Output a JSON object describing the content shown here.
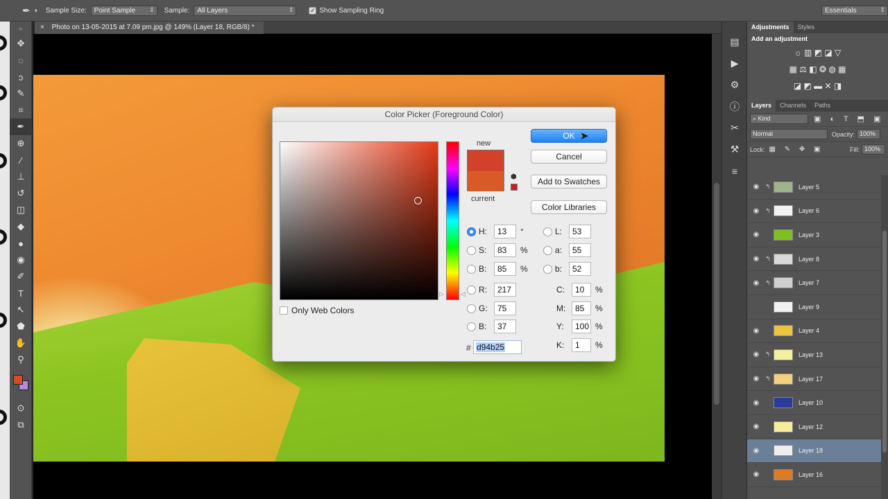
{
  "options_bar": {
    "sample_size_label": "Sample Size:",
    "sample_size_value": "Point Sample",
    "sample_label": "Sample:",
    "sample_value": "All Layers",
    "sampling_ring_label": "Show Sampling Ring",
    "workspace": "Essentials"
  },
  "document": {
    "tab_title": "Photo on 13-05-2015 at 7.09 pm.jpg @ 149% (Layer 18, RGB/8) *",
    "close": "×"
  },
  "toolbox": {
    "tools": [
      "move-icon",
      "marquee-icon",
      "lasso-icon",
      "quick-select-icon",
      "crop-icon",
      "eyedropper-icon",
      "healing-icon",
      "brush-icon",
      "stamp-icon",
      "history-brush-icon",
      "eraser-icon",
      "bucket-icon",
      "blur-icon",
      "dodge-icon",
      "pen-icon",
      "type-icon",
      "path-select-icon",
      "shape-icon",
      "hand-icon",
      "zoom-icon"
    ],
    "glyphs": [
      "✥",
      "◌",
      "ↄ",
      "✎",
      "⌗",
      "✒",
      "⊕",
      "∕",
      "⊥",
      "↺",
      "◫",
      "◆",
      "●",
      "◉",
      "✐",
      "T",
      "↖",
      "⬟",
      "✋",
      "⚲"
    ],
    "foreground_color": "#d94b25",
    "background_color": "#b889e0"
  },
  "panels": {
    "adjustments_tab": "Adjustments",
    "styles_tab": "Styles",
    "add_adjustment": "Add an adjustment",
    "adj_row1": "☼ ▥ ◩ ◪ ▽",
    "adj_row2": "▦ ⚖ ◧ ❂ ◍ ▦",
    "adj_row3": "◪ ◩ ▬ ✕ ◨",
    "layers_tab": "Layers",
    "channels_tab": "Channels",
    "paths_tab": "Paths",
    "kind_filter": "⌕ Kind",
    "filter_icons": "▣ ◐ T ⬒ ▣",
    "blend_mode": "Normal",
    "opacity_label": "Opacity:",
    "opacity_value": "100%",
    "lock_label": "Lock:",
    "lock_icons": "▦ ✎ ✥ ▣",
    "fill_label": "Fill:",
    "fill_value": "100%",
    "layers": [
      {
        "name": "Layer 5",
        "eye": "◉",
        "clip": "↰",
        "thumb": "#9fb48a"
      },
      {
        "name": "Layer 6",
        "eye": "◉",
        "clip": "↰",
        "thumb": "#f2f2f2"
      },
      {
        "name": "Layer 3",
        "eye": "◉",
        "clip": "",
        "thumb": "#7cc11e"
      },
      {
        "name": "Layer 8",
        "eye": "◉",
        "clip": "↰",
        "thumb": "#d8d8d8"
      },
      {
        "name": "Layer 7",
        "eye": "◉",
        "clip": "↰",
        "thumb": "#cfcfcf"
      },
      {
        "name": "Layer 9",
        "eye": "",
        "clip": "",
        "thumb": "#f2f2f2"
      },
      {
        "name": "Layer 4",
        "eye": "◉",
        "clip": "",
        "thumb": "#eac43c"
      },
      {
        "name": "Layer 13",
        "eye": "◉",
        "clip": "↰",
        "thumb": "#f3f0a0"
      },
      {
        "name": "Layer 17",
        "eye": "◉",
        "clip": "↰",
        "thumb": "#f5d080"
      },
      {
        "name": "Layer 10",
        "eye": "◉",
        "clip": "",
        "thumb": "#2c3a9a"
      },
      {
        "name": "Layer 12",
        "eye": "◉",
        "clip": "",
        "thumb": "#f6ef9a"
      },
      {
        "name": "Layer 18",
        "eye": "◉",
        "clip": "",
        "thumb": "#eeeeee"
      },
      {
        "name": "Layer 16",
        "eye": "◉",
        "clip": "",
        "thumb": "#e07a22"
      }
    ],
    "icon_column": [
      "▤",
      "▶",
      "⚙",
      "ⓘ",
      "✂",
      "⚒",
      "≡"
    ]
  },
  "dialog": {
    "title": "Color Picker (Foreground Color)",
    "ok": "OK",
    "cancel": "Cancel",
    "add_to_swatches": "Add to Swatches",
    "color_libraries": "Color Libraries",
    "new_label": "new",
    "current_label": "current",
    "new_color": "#d2412a",
    "current_color": "#d95a26",
    "only_web_colors": "Only Web Colors",
    "hsb": {
      "H": "13",
      "S": "83",
      "B": "85"
    },
    "hsb_units": {
      "H": "°",
      "S": "%",
      "B": "%"
    },
    "lab": {
      "L": "53",
      "a": "55",
      "b": "52"
    },
    "rgb": {
      "R": "217",
      "G": "75",
      "B": "37"
    },
    "cmyk": {
      "C": "10",
      "M": "85",
      "Y": "100",
      "K": "1"
    },
    "hex_prefix": "#",
    "hex": "d94b25",
    "selected_mode": "H"
  }
}
